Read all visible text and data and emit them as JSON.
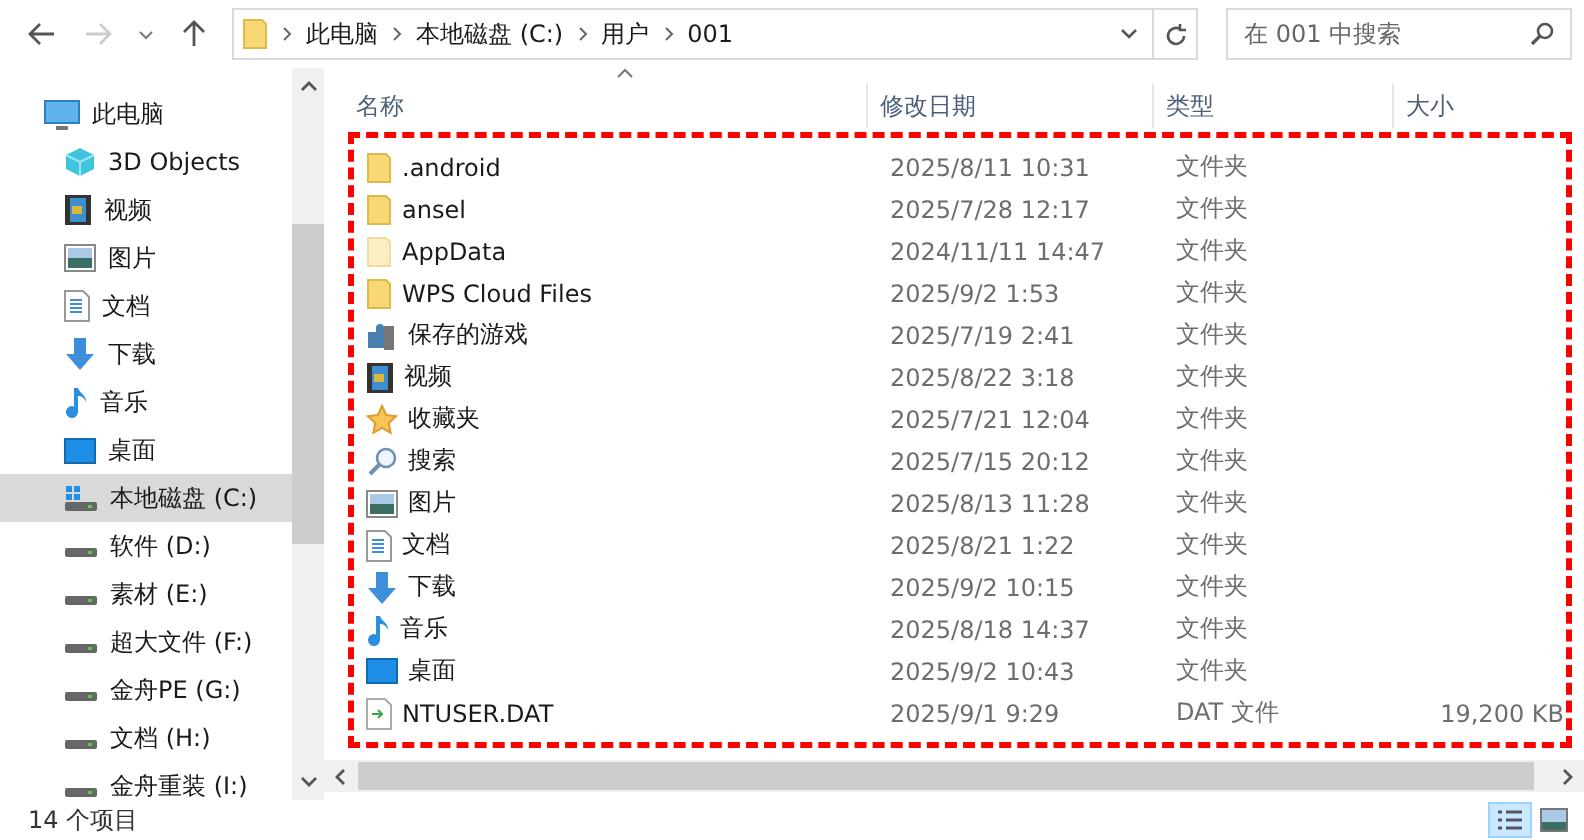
{
  "address_bar": {
    "path": [
      "此电脑",
      "本地磁盘 (C:)",
      "用户",
      "001"
    ]
  },
  "search": {
    "placeholder": "在 001 中搜索"
  },
  "sidebar": {
    "items": [
      {
        "label": "此电脑",
        "kind": "pc",
        "selected": false,
        "children": [
          {
            "label": "3D Objects",
            "kind": "cube",
            "selected": false
          },
          {
            "label": "视频",
            "kind": "video",
            "selected": false
          },
          {
            "label": "图片",
            "kind": "pictures",
            "selected": false
          },
          {
            "label": "文档",
            "kind": "documents",
            "selected": false
          },
          {
            "label": "下载",
            "kind": "downloads",
            "selected": false
          },
          {
            "label": "音乐",
            "kind": "music",
            "selected": false
          },
          {
            "label": "桌面",
            "kind": "desktop",
            "selected": false
          },
          {
            "label": "本地磁盘 (C:)",
            "kind": "system-drive",
            "selected": true
          },
          {
            "label": "软件 (D:)",
            "kind": "drive",
            "selected": false
          },
          {
            "label": "素材 (E:)",
            "kind": "drive",
            "selected": false
          },
          {
            "label": "超大文件 (F:)",
            "kind": "drive",
            "selected": false
          },
          {
            "label": "金舟PE (G:)",
            "kind": "drive",
            "selected": false
          },
          {
            "label": "文档 (H:)",
            "kind": "drive",
            "selected": false
          },
          {
            "label": "金舟重装 (I:)",
            "kind": "drive",
            "selected": false
          }
        ]
      }
    ]
  },
  "table": {
    "columns": [
      "名称",
      "修改日期",
      "类型",
      "大小"
    ],
    "rows": [
      {
        "name": ".android",
        "date": "2025/8/11 10:31",
        "type": "文件夹",
        "kind": "folder"
      },
      {
        "name": "ansel",
        "date": "2025/7/28 12:17",
        "type": "文件夹",
        "kind": "folder"
      },
      {
        "name": "AppData",
        "date": "2024/11/11 14:47",
        "type": "文件夹",
        "kind": "hidden-folder"
      },
      {
        "name": "WPS Cloud Files",
        "date": "2025/9/2 1:53",
        "type": "文件夹",
        "kind": "folder"
      },
      {
        "name": "保存的游戏",
        "date": "2025/7/19 2:41",
        "type": "文件夹",
        "kind": "games"
      },
      {
        "name": "视频",
        "date": "2025/8/22 3:18",
        "type": "文件夹",
        "kind": "video"
      },
      {
        "name": "收藏夹",
        "date": "2025/7/21 12:04",
        "type": "文件夹",
        "kind": "favorites"
      },
      {
        "name": "搜索",
        "date": "2025/7/15 20:12",
        "type": "文件夹",
        "kind": "search"
      },
      {
        "name": "图片",
        "date": "2025/8/13 11:28",
        "type": "文件夹",
        "kind": "pictures"
      },
      {
        "name": "文档",
        "date": "2025/8/21 1:22",
        "type": "文件夹",
        "kind": "documents"
      },
      {
        "name": "下载",
        "date": "2025/9/2 10:15",
        "type": "文件夹",
        "kind": "downloads"
      },
      {
        "name": "音乐",
        "date": "2025/8/18 14:37",
        "type": "文件夹",
        "kind": "music"
      },
      {
        "name": "桌面",
        "date": "2025/9/2 10:43",
        "type": "文件夹",
        "kind": "desktop"
      },
      {
        "name": "NTUSER.DAT",
        "date": "2025/9/1 9:29",
        "type": "DAT 文件",
        "size": "19,200 KB",
        "kind": "file"
      }
    ]
  },
  "status_bar": {
    "item_count": "14 个项目"
  }
}
